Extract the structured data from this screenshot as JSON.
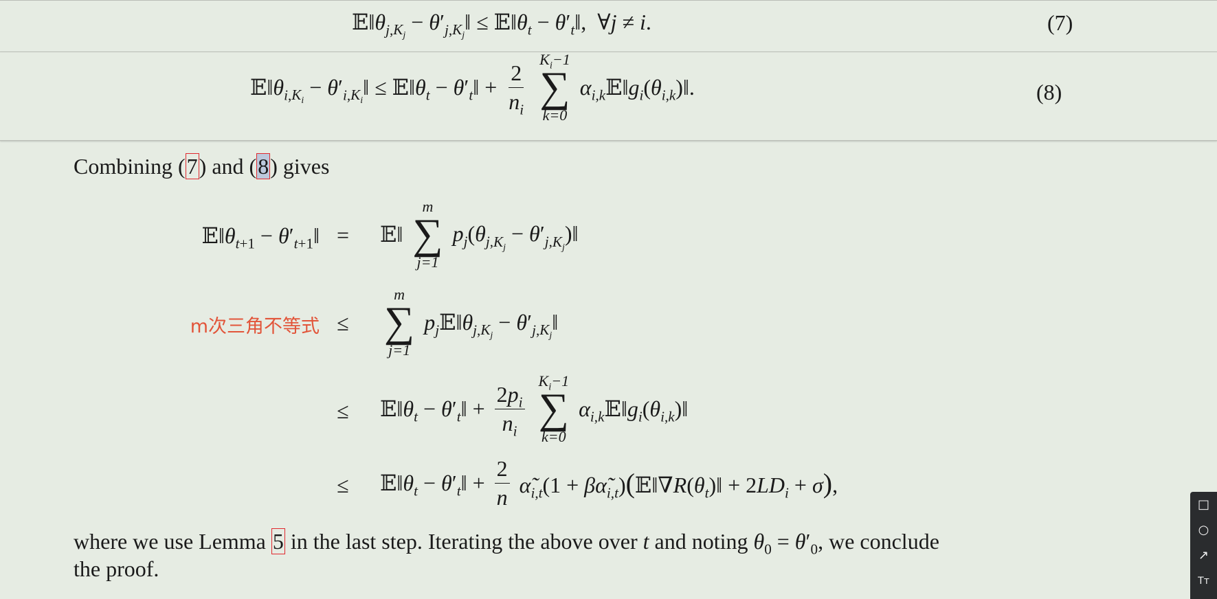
{
  "eq7": {
    "number": "(7)"
  },
  "eq8": {
    "number": "(8)"
  },
  "paragraph1": {
    "before": "Combining (",
    "ref7": "7",
    "middle": ") and (",
    "ref8": "8",
    "after": ") gives"
  },
  "annotation": {
    "note": "m次三角不等式"
  },
  "relations": {
    "eq": "=",
    "leq": "≤"
  },
  "paragraph2": {
    "line1_a": "where we use Lemma ",
    "ref_lemma": "5",
    "line1_b": " in the last step. Iterating the above over ",
    "line1_c": " and noting ",
    "line1_d": ", we conclude",
    "line2": "the proof."
  },
  "toolbar": {
    "tools": [
      {
        "icon": "rectangle-icon",
        "glyph": "□"
      },
      {
        "icon": "circle-icon",
        "glyph": "○"
      },
      {
        "icon": "arrow-icon",
        "glyph": "↗"
      },
      {
        "icon": "text-tool-icon",
        "glyph": "Tт"
      }
    ]
  },
  "colors": {
    "background": "#e6ece3",
    "annotation": "#e2553a",
    "reference_box": "#e0282e",
    "highlight": "#bcc8dc",
    "toolbar": "#2a2c2e"
  }
}
